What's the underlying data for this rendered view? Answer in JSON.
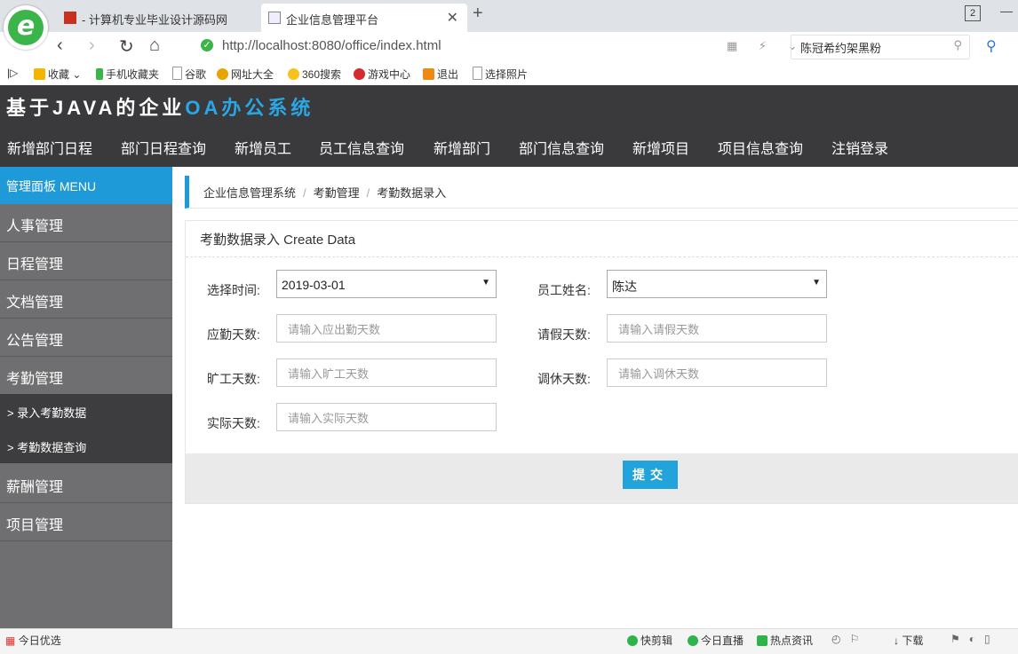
{
  "browser": {
    "tabs": [
      {
        "title": "- 计算机专业毕业设计源码网"
      },
      {
        "title": "企业信息管理平台"
      }
    ],
    "tab_count": "2",
    "url": "http://localhost:8080/office/index.html",
    "search_value": "陈冠希约架黑粉",
    "bookmarks": [
      "收藏",
      "手机收藏夹",
      "谷歌",
      "网址大全",
      "360搜索",
      "游戏中心",
      "退出",
      "选择照片"
    ]
  },
  "app": {
    "title_main": "基于JAVA的企业",
    "title_accent": "OA办公系统",
    "nav": [
      "新增部门日程",
      "部门日程查询",
      "新增员工",
      "员工信息查询",
      "新增部门",
      "部门信息查询",
      "新增项目",
      "项目信息查询",
      "注销登录"
    ]
  },
  "sidebar": {
    "header": "管理面板 MENU",
    "items": [
      "人事管理",
      "日程管理",
      "文档管理",
      "公告管理",
      "考勤管理"
    ],
    "subitems": [
      "> 录入考勤数据",
      "> 考勤数据查询"
    ],
    "items_after": [
      "薪酬管理",
      "项目管理"
    ]
  },
  "breadcrumb": [
    "企业信息管理系统",
    "考勤管理",
    "考勤数据录入"
  ],
  "form": {
    "title": "考勤数据录入 Create Data",
    "date_label": "选择时间:",
    "date_value": "2019-03-01",
    "employee_label": "员工姓名:",
    "employee_value": "陈达",
    "due_days_label": "应勤天数:",
    "due_days_placeholder": "请输入应出勤天数",
    "leave_days_label": "请假天数:",
    "leave_days_placeholder": "请输入请假天数",
    "absent_days_label": "旷工天数:",
    "absent_days_placeholder": "请输入旷工天数",
    "adjust_days_label": "调休天数:",
    "adjust_days_placeholder": "请输入调休天数",
    "actual_days_label": "实际天数:",
    "actual_days_placeholder": "请输入实际天数",
    "submit": "提交"
  },
  "statusbar": {
    "left": "今日优选",
    "items": [
      "快剪辑",
      "今日直播",
      "热点资讯",
      "下载"
    ]
  },
  "colors": {
    "accent": "#1f9ad8",
    "header_bg": "#3a3a3c",
    "sidebar_bg": "#6f6f71"
  }
}
